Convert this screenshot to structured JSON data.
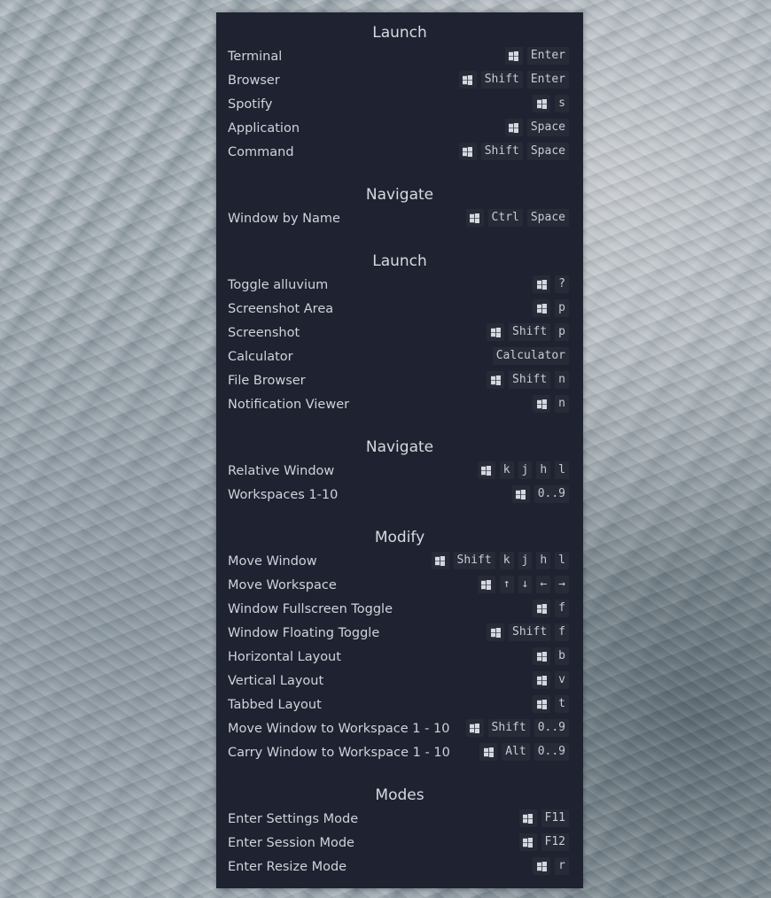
{
  "sections": [
    {
      "title": "Launch",
      "rows": [
        {
          "label": "Terminal",
          "keys": [
            "WIN",
            "Enter"
          ]
        },
        {
          "label": "Browser",
          "keys": [
            "WIN",
            "Shift",
            "Enter"
          ]
        },
        {
          "label": "Spotify",
          "keys": [
            "WIN",
            "s"
          ]
        },
        {
          "label": "Application",
          "keys": [
            "WIN",
            "Space"
          ]
        },
        {
          "label": "Command",
          "keys": [
            "WIN",
            "Shift",
            "Space"
          ]
        }
      ]
    },
    {
      "title": "Navigate",
      "rows": [
        {
          "label": "Window by Name",
          "keys": [
            "WIN",
            "Ctrl",
            "Space"
          ]
        }
      ]
    },
    {
      "title": "Launch",
      "rows": [
        {
          "label": "Toggle alluvium",
          "keys": [
            "WIN",
            "?"
          ]
        },
        {
          "label": "Screenshot Area",
          "keys": [
            "WIN",
            "p"
          ]
        },
        {
          "label": "Screenshot",
          "keys": [
            "WIN",
            "Shift",
            "p"
          ]
        },
        {
          "label": "Calculator",
          "keys": [
            "Calculator"
          ]
        },
        {
          "label": "File Browser",
          "keys": [
            "WIN",
            "Shift",
            "n"
          ]
        },
        {
          "label": "Notification Viewer",
          "keys": [
            "WIN",
            "n"
          ]
        }
      ]
    },
    {
      "title": "Navigate",
      "rows": [
        {
          "label": "Relative Window",
          "keys": [
            "WIN",
            "k",
            "j",
            "h",
            "l"
          ]
        },
        {
          "label": "Workspaces 1-10",
          "keys": [
            "WIN",
            "0..9"
          ]
        }
      ]
    },
    {
      "title": "Modify",
      "rows": [
        {
          "label": "Move Window",
          "keys": [
            "WIN",
            "Shift",
            "k",
            "j",
            "h",
            "l"
          ]
        },
        {
          "label": "Move Workspace",
          "keys": [
            "WIN",
            "↑",
            "↓",
            "←",
            "→"
          ]
        },
        {
          "label": "Window Fullscreen Toggle",
          "keys": [
            "WIN",
            "f"
          ]
        },
        {
          "label": "Window Floating Toggle",
          "keys": [
            "WIN",
            "Shift",
            "f"
          ]
        },
        {
          "label": "Horizontal Layout",
          "keys": [
            "WIN",
            "b"
          ]
        },
        {
          "label": "Vertical Layout",
          "keys": [
            "WIN",
            "v"
          ]
        },
        {
          "label": "Tabbed Layout",
          "keys": [
            "WIN",
            "t"
          ]
        },
        {
          "label": "Move Window to Workspace 1 - 10",
          "keys": [
            "WIN",
            "Shift",
            "0..9"
          ]
        },
        {
          "label": "Carry Window to Workspace 1 - 10",
          "keys": [
            "WIN",
            "Alt",
            "0..9"
          ]
        }
      ]
    },
    {
      "title": "Modes",
      "rows": [
        {
          "label": "Enter Settings Mode",
          "keys": [
            "WIN",
            "F11"
          ]
        },
        {
          "label": "Enter Session Mode",
          "keys": [
            "WIN",
            "F12"
          ]
        },
        {
          "label": "Enter Resize Mode",
          "keys": [
            "WIN",
            "r"
          ]
        }
      ]
    }
  ],
  "icons": {
    "super_key": "windows-logo-icon"
  },
  "colors": {
    "panel_bg": "#1f2230",
    "key_bg": "#272a37",
    "text": "#d0d3da"
  }
}
